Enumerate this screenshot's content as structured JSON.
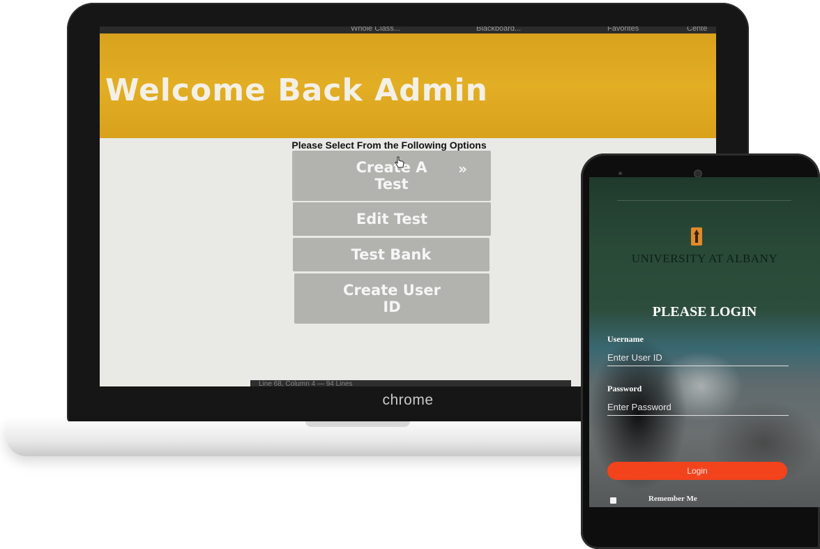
{
  "laptop": {
    "bookmarks": [
      "",
      "Whole Class...",
      "Blackboard...",
      "Favorites",
      "Cente"
    ],
    "banner_title": "Welcome Back Admin",
    "options_prompt": "Please Select From the Following Options",
    "menu": {
      "create_test_line1": "Create A",
      "create_test_line2": "Test",
      "chevron": "»",
      "edit_test": "Edit Test",
      "test_bank": "Test Bank",
      "create_user_line1": "Create User",
      "create_user_line2": "ID"
    },
    "status_bar": "Line 68, Column 4 — 94 Lines",
    "brand_label": "chrome"
  },
  "phone": {
    "university_name": "UNIVERSITY AT ALBANY",
    "login_heading": "PLEASE LOGIN",
    "username_label": "Username",
    "username_placeholder": "Enter User ID",
    "password_label": "Password",
    "password_placeholder": "Enter Password",
    "login_button": "Login",
    "remember_me": "Remember Me"
  },
  "colors": {
    "banner": "#e2ae24",
    "menu_button": "#b2b2af",
    "login_button": "#f2431d"
  }
}
